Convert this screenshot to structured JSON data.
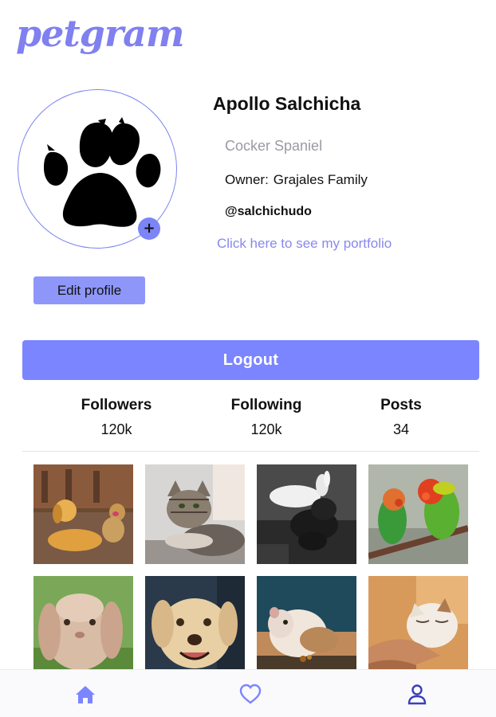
{
  "app": {
    "logo": "petgram"
  },
  "profile": {
    "name": "Apollo Salchicha",
    "breed": "Cocker Spaniel",
    "owner_label": "Owner:",
    "owner_value": "Grajales Family",
    "handle": "@salchichudo",
    "portfolio_link": "Click here to see my portfolio",
    "avatar_add_label": "+",
    "edit_button": "Edit profile"
  },
  "actions": {
    "logout": "Logout"
  },
  "stats": [
    {
      "label": "Followers",
      "value": "120k"
    },
    {
      "label": "Following",
      "value": "120k"
    },
    {
      "label": "Posts",
      "value": "34"
    }
  ],
  "posts": [
    {
      "subject": "golden retriever dogs"
    },
    {
      "subject": "tabby cat"
    },
    {
      "subject": "rabbit and dog black and white"
    },
    {
      "subject": "lovebirds parrots"
    },
    {
      "subject": "lop eared rabbit"
    },
    {
      "subject": "labrador dog"
    },
    {
      "subject": "hamster"
    },
    {
      "subject": "cat being petted"
    }
  ],
  "bottom_nav": [
    {
      "icon": "home-icon",
      "active": false
    },
    {
      "icon": "heart-icon",
      "active": false
    },
    {
      "icon": "user-icon",
      "active": true
    }
  ],
  "colors": {
    "accent": "#7b85ff",
    "logo": "#8080f0",
    "link": "#8888ee",
    "muted_text": "#9a9aa6",
    "nav_active": "#3b3fb8"
  }
}
